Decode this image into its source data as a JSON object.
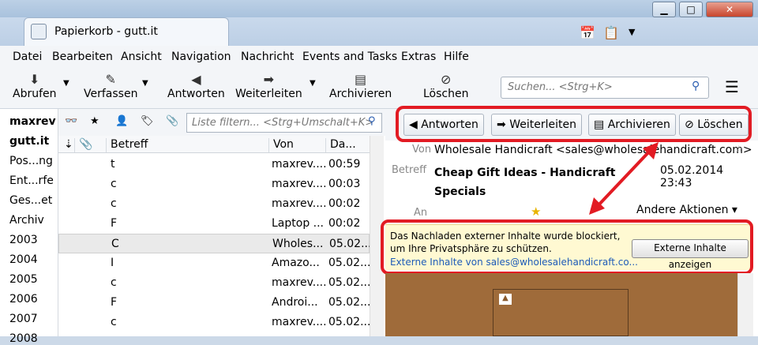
{
  "window": {
    "minimize": "▁",
    "maximize": "□",
    "close": "✕"
  },
  "tab": {
    "title": "Papierkorb - gutt.it"
  },
  "menu": [
    "Datei",
    "Bearbeiten",
    "Ansicht",
    "Navigation",
    "Nachricht",
    "Events and Tasks",
    "Extras",
    "Hilfe"
  ],
  "toolbar": {
    "fetch": "Abrufen",
    "compose": "Verfassen",
    "reply": "Antworten",
    "forward": "Weiterleiten",
    "archive": "Archivieren",
    "delete": "Löschen",
    "search_placeholder": "Suchen... <Strg+K>"
  },
  "folders": [
    "maxrev",
    "gutt.it",
    "Pos...ng",
    "Ent...rfe",
    "Ges...et",
    "Archiv",
    "2003",
    "2004",
    "2005",
    "2006",
    "2007",
    "2008"
  ],
  "filter": {
    "placeholder": "Liste filtern... <Strg+Umschalt+K>"
  },
  "columns": {
    "subject": "Betreff",
    "from": "Von",
    "date": "Da..."
  },
  "rows": [
    {
      "s": "t",
      "f": "maxrev....",
      "d": "00:59"
    },
    {
      "s": "c",
      "f": "maxrev....",
      "d": "00:03"
    },
    {
      "s": "c",
      "f": "maxrev....",
      "d": "00:02"
    },
    {
      "s": "F",
      "f": "Laptop ...",
      "d": "00:02"
    },
    {
      "s": "C",
      "f": "Wholes...",
      "d": "05.02...."
    },
    {
      "s": "I",
      "f": "Amazo...",
      "d": "05.02...."
    },
    {
      "s": "c",
      "f": "maxrev....",
      "d": "05.02...."
    },
    {
      "s": "F",
      "f": "Androi...",
      "d": "05.02...."
    },
    {
      "s": "c",
      "f": "maxrev....",
      "d": "05.02...."
    }
  ],
  "message": {
    "buttons": {
      "reply": "Antworten",
      "forward": "Weiterleiten",
      "archive": "Archivieren",
      "delete": "Löschen"
    },
    "from_label": "Von",
    "from": "Wholesale Handicraft <sales@wholesalehandicraft.com>",
    "subject_label": "Betreff",
    "subject": "Cheap Gift Ideas - Handicraft Specials",
    "date": "05.02.2014 23:43",
    "to_label": "An",
    "more_actions": "Andere Aktionen"
  },
  "notification": {
    "text": "Das Nachladen externer Inhalte wurde blockiert, um Ihre Privatsphäre zu schützen.",
    "link": "Externe Inhalte von sales@wholesalehandicraft.co...",
    "button": "Externe Inhalte anzeigen"
  },
  "colors": {
    "highlight": "#e21b23",
    "notification_bg": "#fff9d2",
    "link": "#1e5bb8"
  }
}
